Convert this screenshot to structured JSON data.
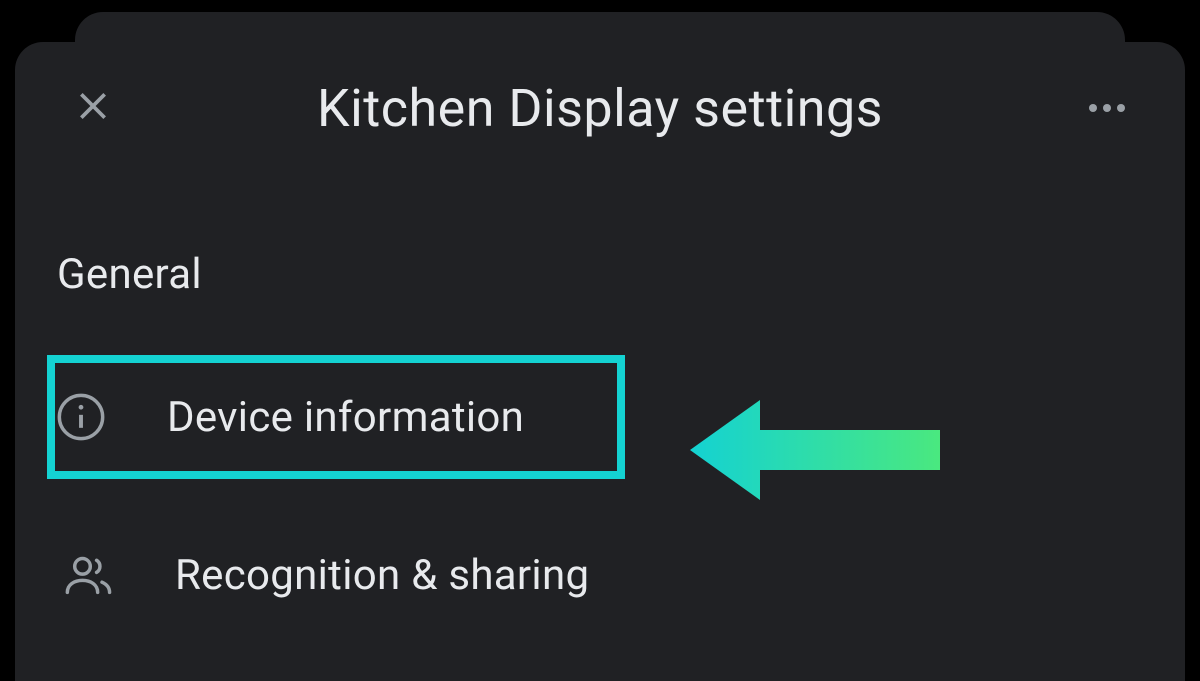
{
  "header": {
    "title": "Kitchen Display settings"
  },
  "section": {
    "title": "General",
    "items": [
      {
        "label": "Device information",
        "icon": "info",
        "highlighted": true
      },
      {
        "label": "Recognition & sharing",
        "icon": "people",
        "highlighted": false
      }
    ]
  },
  "annotation": {
    "arrow_color_start": "#14d2d2",
    "arrow_color_end": "#4ae87f",
    "highlight_color": "#14d2d2"
  }
}
